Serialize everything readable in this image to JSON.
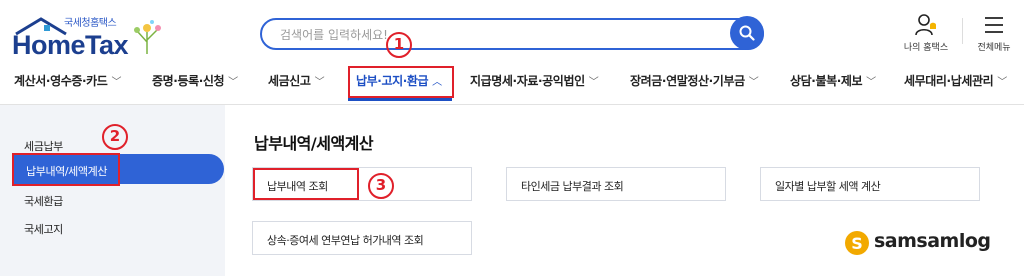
{
  "header": {
    "logo_sub": "국세청홈택스",
    "logo_main": "HomeTax",
    "search_placeholder": "검색어를 입력하세요!",
    "util_my": "나의 홈택스",
    "util_all": "전체메뉴"
  },
  "nav": {
    "items": [
      {
        "label": "계산서·영수증·카드"
      },
      {
        "label": "증명·등록·신청"
      },
      {
        "label": "세금신고"
      },
      {
        "label": "납부·고지·환급"
      },
      {
        "label": "지급명세·자료·공익법인"
      },
      {
        "label": "장려금·연말정산·기부금"
      },
      {
        "label": "상담·불복·제보"
      },
      {
        "label": "세무대리·납세관리"
      }
    ],
    "active_index": 3
  },
  "sidebar": {
    "items": [
      {
        "label": "세금납부"
      },
      {
        "label": "납부내역/세액계산"
      },
      {
        "label": "국세환급"
      },
      {
        "label": "국세고지"
      }
    ],
    "active_index": 1
  },
  "main": {
    "title": "납부내역/세액계산",
    "cards": [
      {
        "label": "납부내역 조회"
      },
      {
        "label": "타인세금 납부결과 조회"
      },
      {
        "label": "일자별 납부할 세액 계산"
      },
      {
        "label": "상속·증여세 연부연납 허가내역 조회"
      }
    ]
  },
  "annotations": {
    "step1": "1",
    "step2": "2",
    "step3": "3",
    "color": "#e0202a"
  },
  "watermark": {
    "text": "samsamlog"
  },
  "colors": {
    "brand_blue": "#2f63d6",
    "nav_active": "#1d4fc4",
    "logo_navy": "#1c3f8f"
  }
}
